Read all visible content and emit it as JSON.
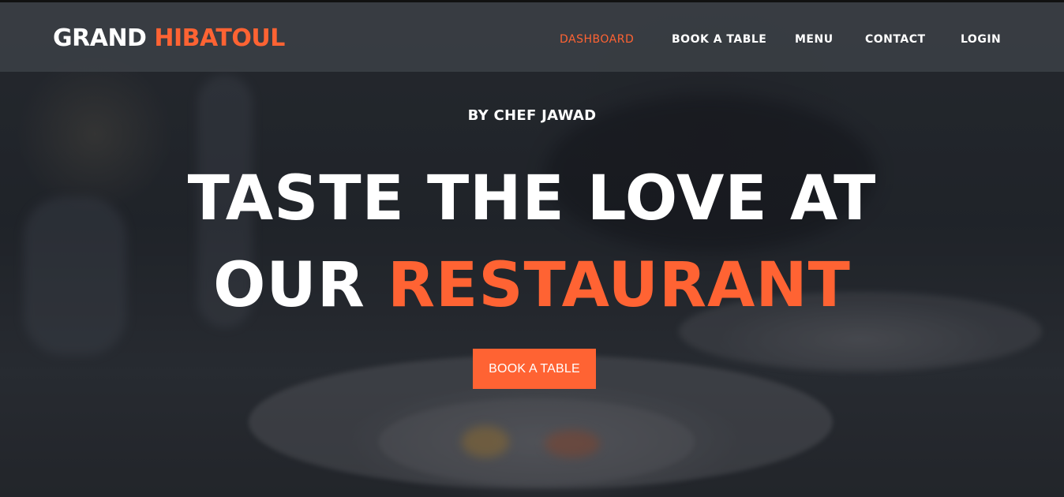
{
  "brand": {
    "part1": "GRAND",
    "part2": "HIBATOUL",
    "accent_color": "#ff6333"
  },
  "nav": {
    "items": [
      {
        "label": "DASHBOARD",
        "active": true
      },
      {
        "label": "BOOK A TABLE",
        "active": false
      },
      {
        "label": "MENU",
        "active": false
      },
      {
        "label": "CONTACT",
        "active": false
      },
      {
        "label": "LOGIN",
        "active": false
      }
    ]
  },
  "hero": {
    "byline": "BY CHEF JAWAD",
    "headline_line1": "TASTE THE LOVE AT",
    "headline_line2_white": "OUR",
    "headline_line2_accent": "RESTAURANT",
    "cta_label": "BOOK A TABLE",
    "background": "blurred restaurant table photo"
  }
}
